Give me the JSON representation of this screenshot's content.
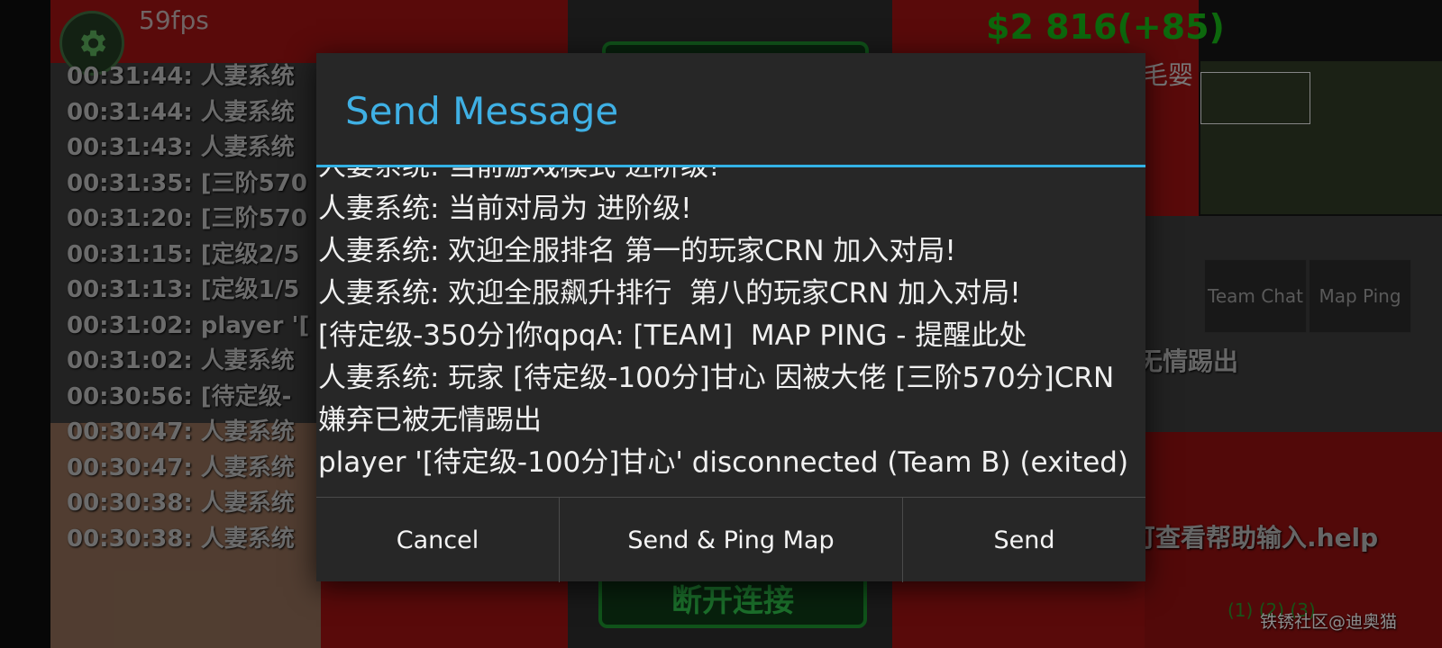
{
  "hud": {
    "fps": "59fps",
    "credits": "$2 816(+85)",
    "credits_suffix": "毛婴",
    "team_chat": "Team Chat",
    "map_ping": "Map Ping",
    "disconnect": "断开连接",
    "right_msg_1": "无情踢出",
    "right_msg_2": "可查看帮助输入.help",
    "control_groups": "(1)      (2)      (3)",
    "watermark": "铁锈社区@迪奥猫"
  },
  "background_chat": [
    "00:31:44: 人妻系统",
    "00:31:44: 人妻系统",
    "00:31:43: 人妻系统",
    "00:31:35: [三阶570",
    "00:31:20: [三阶570",
    "00:31:15: [定级2/5",
    "00:31:13: [定级1/5",
    "00:31:02: player '[",
    "00:31:02: 人妻系统",
    "00:30:56: [待定级-",
    "00:30:47: 人妻系统",
    "00:30:47: 人妻系统",
    "00:30:38: 人妻系统",
    "00:30:38: 人妻系统"
  ],
  "dialog": {
    "title": "Send Message",
    "messages": [
      "人妻系统: 当前游戏模式 进阶级!",
      "人妻系统: 当前对局为 进阶级!",
      "人妻系统: 欢迎全服排名 第一的玩家CRN 加入对局!",
      "人妻系统: 欢迎全服飙升排行  第八的玩家CRN 加入对局!",
      "[待定级-350分]你qpqA: [TEAM]  MAP PING - 提醒此处",
      "人妻系统: 玩家 [待定级-100分]甘心 因被大佬 [三阶570分]CRN 嫌弃已被无情踢出",
      "player '[待定级-100分]甘心' disconnected (Team B) (exited)"
    ],
    "buttons": {
      "cancel": "Cancel",
      "send_ping": "Send & Ping Map",
      "send": "Send"
    }
  },
  "colors": {
    "title": "#3fb0e4",
    "credits": "#18b318",
    "dialog_bg": "#272727"
  }
}
